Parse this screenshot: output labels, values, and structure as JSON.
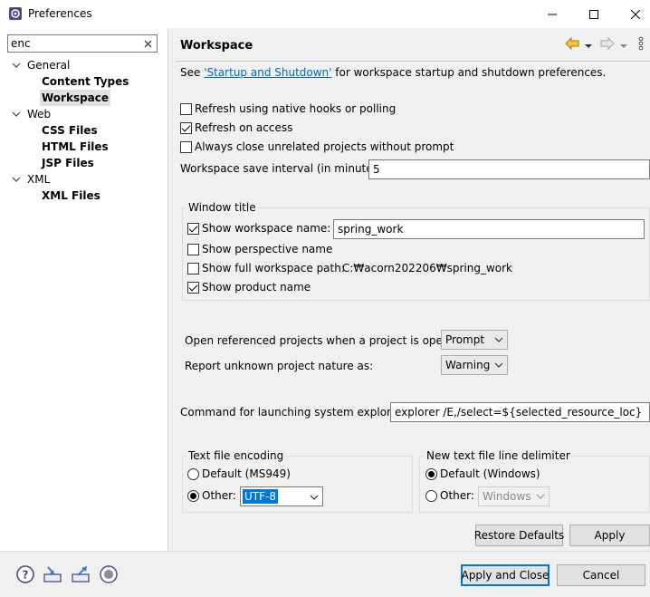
{
  "window": {
    "title": "Preferences",
    "controls": [
      "minimize",
      "maximize",
      "close"
    ]
  },
  "filter": {
    "value": "enc"
  },
  "tree": [
    {
      "label": "General",
      "level": 0,
      "expanded": true
    },
    {
      "label": "Content Types",
      "level": 1
    },
    {
      "label": "Workspace",
      "level": 1,
      "selected": true
    },
    {
      "label": "Web",
      "level": 0,
      "expanded": true
    },
    {
      "label": "CSS Files",
      "level": 1
    },
    {
      "label": "HTML Files",
      "level": 1
    },
    {
      "label": "JSP Files",
      "level": 1
    },
    {
      "label": "XML",
      "level": 0,
      "expanded": true
    },
    {
      "label": "XML Files",
      "level": 1
    }
  ],
  "page": {
    "title": "Workspace",
    "intro_prefix": "See ",
    "intro_link": "'Startup and Shutdown'",
    "intro_suffix": " for workspace startup and shutdown preferences."
  },
  "options": {
    "refresh_native": {
      "label": "Refresh using native hooks or polling",
      "checked": false
    },
    "refresh_access": {
      "label": "Refresh on access",
      "checked": true
    },
    "always_close": {
      "label": "Always close unrelated projects without prompt",
      "checked": false
    },
    "save_interval_label": "Workspace save interval (in minutes):",
    "save_interval_value": "5"
  },
  "window_title_group": {
    "title": "Window title",
    "show_workspace_name": {
      "label": "Show workspace name:",
      "checked": true,
      "value": "spring_work"
    },
    "show_perspective_name": {
      "label": "Show perspective name",
      "checked": false
    },
    "show_full_path": {
      "label": "Show full workspace path:",
      "checked": false,
      "value": "C:₩acorn202206₩spring_work"
    },
    "show_product_name": {
      "label": "Show product name",
      "checked": true
    }
  },
  "projects": {
    "open_referenced_label": "Open referenced projects when a project is opened:",
    "open_referenced_value": "Prompt",
    "unknown_nature_label": "Report unknown project nature as:",
    "unknown_nature_value": "Warning"
  },
  "explorer": {
    "label": "Command for launching system explorer:",
    "value": "explorer /E,/select=${selected_resource_loc}"
  },
  "encoding": {
    "title": "Text file encoding",
    "default_label": "Default (MS949)",
    "other_label": "Other:",
    "other_value": "UTF-8",
    "selected": "other"
  },
  "line_delimiter": {
    "title": "New text file line delimiter",
    "default_label": "Default (Windows)",
    "other_label": "Other:",
    "other_value": "Windows",
    "selected": "default"
  },
  "buttons": {
    "restore_defaults": "Restore Defaults",
    "apply": "Apply",
    "apply_close": "Apply and Close",
    "cancel": "Cancel"
  },
  "colors": {
    "link": "#0066cc",
    "selection": "#0078d7",
    "accent_arrow": "#e8a000"
  }
}
